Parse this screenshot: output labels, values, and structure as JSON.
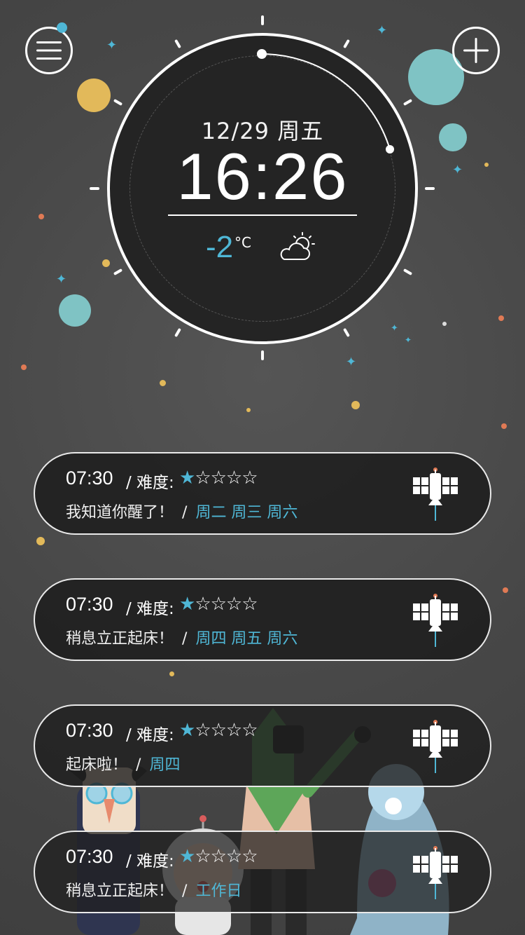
{
  "clock": {
    "date": "12/29 周五",
    "time": "16:26",
    "temperature": "-2",
    "temperature_unit": "°C",
    "weather_icon": "partly-cloudy-icon"
  },
  "header": {
    "menu_icon": "menu-icon",
    "add_icon": "plus-icon"
  },
  "alarms": [
    {
      "time": "07:30",
      "difficulty_label": "/ 难度:",
      "difficulty": 1,
      "difficulty_max": 5,
      "label": "我知道你醒了！",
      "separator": "/",
      "days": "周二 周三 周六",
      "icon": "satellite-icon"
    },
    {
      "time": "07:30",
      "difficulty_label": "/ 难度:",
      "difficulty": 1,
      "difficulty_max": 5,
      "label": "稍息立正起床！",
      "separator": "/",
      "days": "周四 周五 周六",
      "icon": "satellite-icon"
    },
    {
      "time": "07:30",
      "difficulty_label": "/ 难度:",
      "difficulty": 1,
      "difficulty_max": 5,
      "label": "起床啦！",
      "separator": "/",
      "days": "周四",
      "icon": "satellite-icon"
    },
    {
      "time": "07:30",
      "difficulty_label": "/ 难度:",
      "difficulty": 1,
      "difficulty_max": 5,
      "label": "稍息立正起床！",
      "separator": "/",
      "days": "工作日",
      "icon": "satellite-icon"
    }
  ],
  "colors": {
    "accent": "#4fb7d6",
    "background": "#4a4a4a",
    "card_bg": "#1e1e1e"
  }
}
